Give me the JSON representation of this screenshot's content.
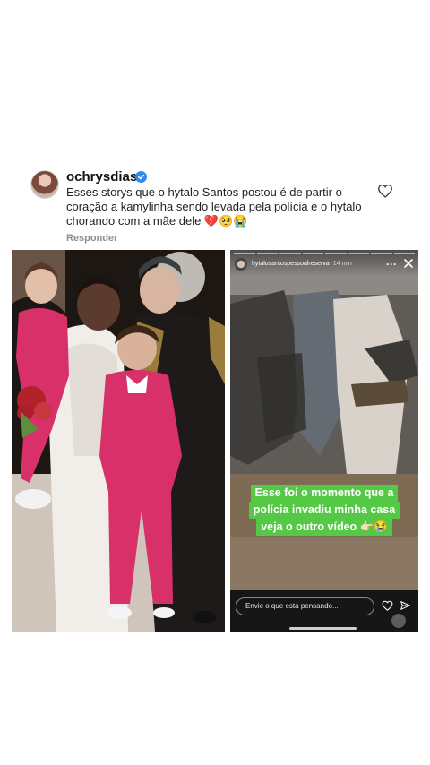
{
  "comment": {
    "username": "ochrysdias",
    "text": "Esses storys que o hytalo Santos postou é de partir o coração a kamylinha sendo levada pela polícia e o hytalo chorando com a mãe dele 💔🥺😭",
    "reply_label": "Responder"
  },
  "story": {
    "username": "hytalosantospessoalreserva",
    "time": "14 min",
    "caption_lines": [
      "Esse foi o momento que a",
      "polícia invadiu minha casa",
      "veja o outro vídeo 👉🏻😭"
    ],
    "reply_placeholder": "Envie o que está pensando..."
  },
  "icons": {
    "like": "heart-icon",
    "verified": "verified-badge-icon",
    "close": "close-icon",
    "more": "more-icon",
    "send": "send-icon"
  },
  "colors": {
    "verified_blue": "#2e8cf0",
    "caption_green": "#55c845",
    "muted_gray": "#8e8e8e"
  }
}
